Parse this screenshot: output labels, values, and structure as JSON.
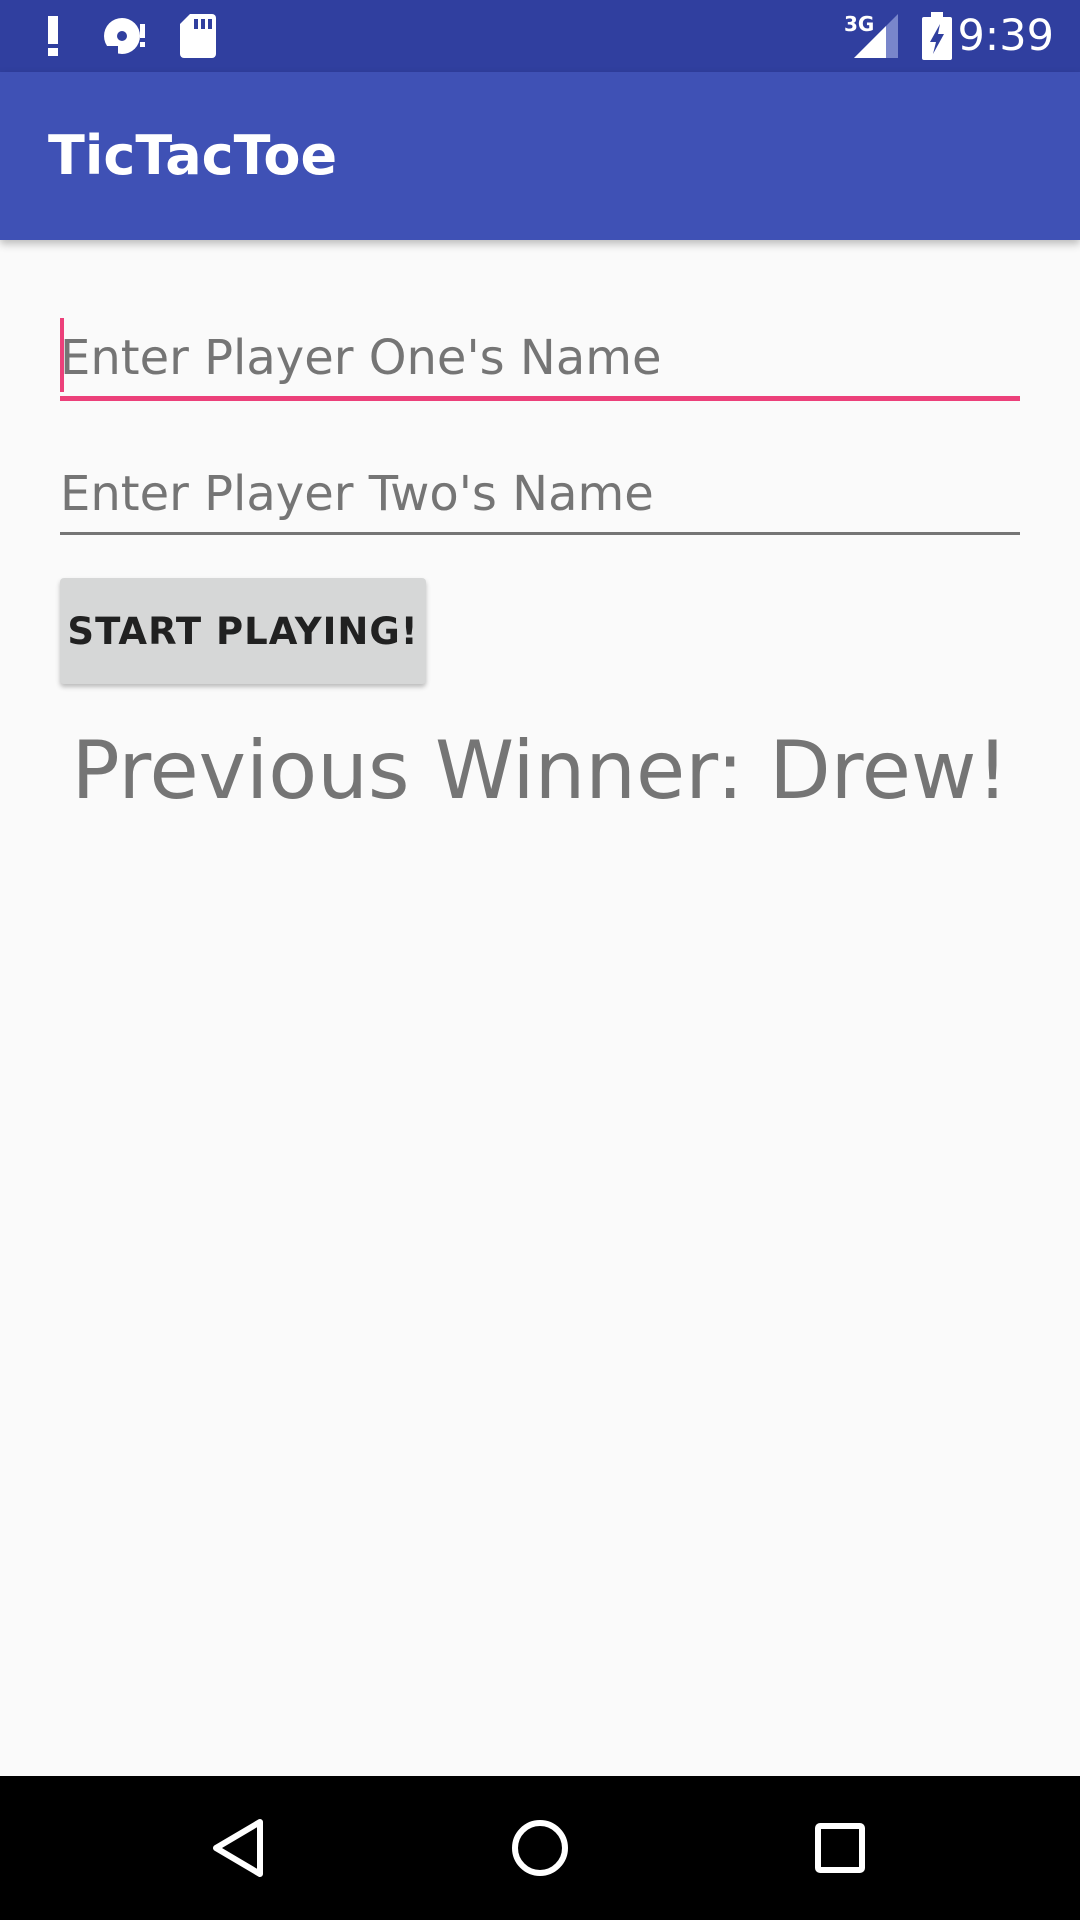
{
  "status_bar": {
    "time": "9:39",
    "network": "3G",
    "icons": [
      "alert-icon",
      "disc-icon",
      "sd-card-icon",
      "signal-icon",
      "battery-charging-icon"
    ]
  },
  "app_bar": {
    "title": "TicTacToe"
  },
  "form": {
    "player_one_placeholder": "Enter Player One's Name",
    "player_one_value": "",
    "player_two_placeholder": "Enter Player Two's Name",
    "player_two_value": "",
    "start_button_label": "START PLAYING!"
  },
  "previous_winner": "Previous Winner: Drew!",
  "nav_bar": {
    "icons": [
      "back-icon",
      "home-icon",
      "recents-icon"
    ]
  },
  "colors": {
    "status_bar": "#303f9f",
    "app_bar": "#3f51b5",
    "accent": "#ec407a",
    "background": "#fafafa",
    "button": "#d6d7d7",
    "hint_text": "#757575"
  }
}
